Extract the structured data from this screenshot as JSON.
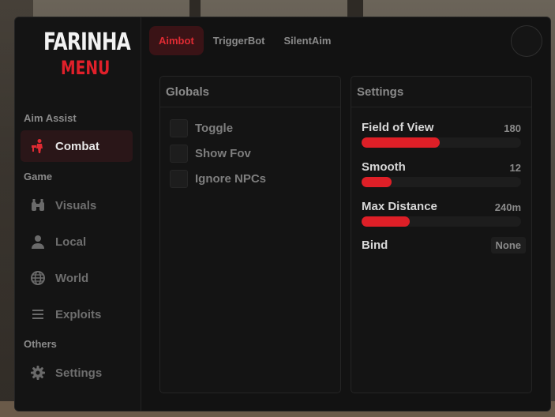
{
  "brand": {
    "line1": "FARINHA",
    "line2": "MENU"
  },
  "tabs": [
    {
      "label": "Aimbot",
      "active": true
    },
    {
      "label": "TriggerBot",
      "active": false
    },
    {
      "label": "SilentAim",
      "active": false
    }
  ],
  "sidebar": {
    "sections": [
      {
        "label": "Aim Assist"
      },
      {
        "label": "Game"
      },
      {
        "label": "Others"
      }
    ],
    "items": [
      {
        "label": "Combat",
        "icon": "combat-icon",
        "active": true
      },
      {
        "label": "Visuals",
        "icon": "binoculars-icon",
        "active": false
      },
      {
        "label": "Local",
        "icon": "user-icon",
        "active": false
      },
      {
        "label": "World",
        "icon": "globe-icon",
        "active": false
      },
      {
        "label": "Exploits",
        "icon": "list-icon",
        "active": false
      },
      {
        "label": "Settings",
        "icon": "gear-icon",
        "active": false
      }
    ]
  },
  "globals": {
    "title": "Globals",
    "toggles": [
      {
        "label": "Toggle",
        "checked": false
      },
      {
        "label": "Show Fov",
        "checked": false
      },
      {
        "label": "Ignore NPCs",
        "checked": false
      }
    ]
  },
  "settings": {
    "title": "Settings",
    "sliders": [
      {
        "label": "Field of View",
        "value": "180",
        "fill": 0.49
      },
      {
        "label": "Smooth",
        "value": "12",
        "fill": 0.19
      },
      {
        "label": "Max Distance",
        "value": "240m",
        "fill": 0.3
      }
    ],
    "bind": {
      "label": "Bind",
      "value": "None"
    }
  },
  "colors": {
    "accent": "#de1f27",
    "panel": "#141414",
    "window": "#121212"
  }
}
